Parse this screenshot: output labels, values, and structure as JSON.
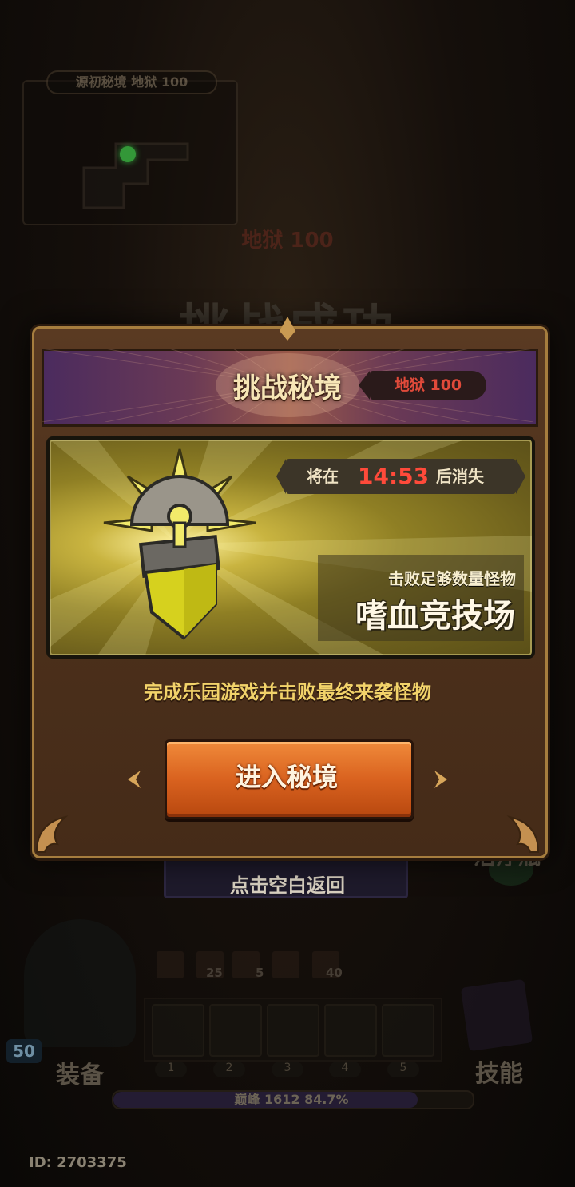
{
  "background": {
    "minimap_title": "源初秘境 地狱 100",
    "level_text": "地狱 100",
    "success_text": "挑战成功",
    "tap_return_text": "点击空白返回",
    "potion_label": "治疗瓶",
    "buffs": [
      {
        "icon": "fire-buff-icon",
        "count": ""
      },
      {
        "icon": "gold-buff-icon",
        "count": "25"
      },
      {
        "icon": "purple-buff-icon",
        "count": "5"
      },
      {
        "icon": "vortex-buff-icon",
        "count": ""
      },
      {
        "icon": "red-buff-icon",
        "count": "40"
      }
    ],
    "slots": [
      "1",
      "2",
      "3",
      "4",
      "5"
    ],
    "equip_label": "装备",
    "skill_label": "技能",
    "level_badge": "50",
    "xp_text": "巅峰 1612 84.7%",
    "xp_progress": 0.847,
    "player_id": "ID: 2703375"
  },
  "modal": {
    "title": "挑战秘境",
    "level_tag": "地狱 100",
    "timer_prefix": "将在",
    "timer_value": "14:53",
    "timer_suffix": "后消失",
    "card_subtitle": "击败足够数量怪物",
    "card_title": "嗜血竞技场",
    "objective": "完成乐园游戏并击败最终来袭怪物",
    "enter_button": "进入秘境",
    "colors": {
      "timer": "#ff4a3a",
      "level_tag": "#e04a3a",
      "objective": "#f2d36a",
      "button": "#d9621f"
    }
  }
}
